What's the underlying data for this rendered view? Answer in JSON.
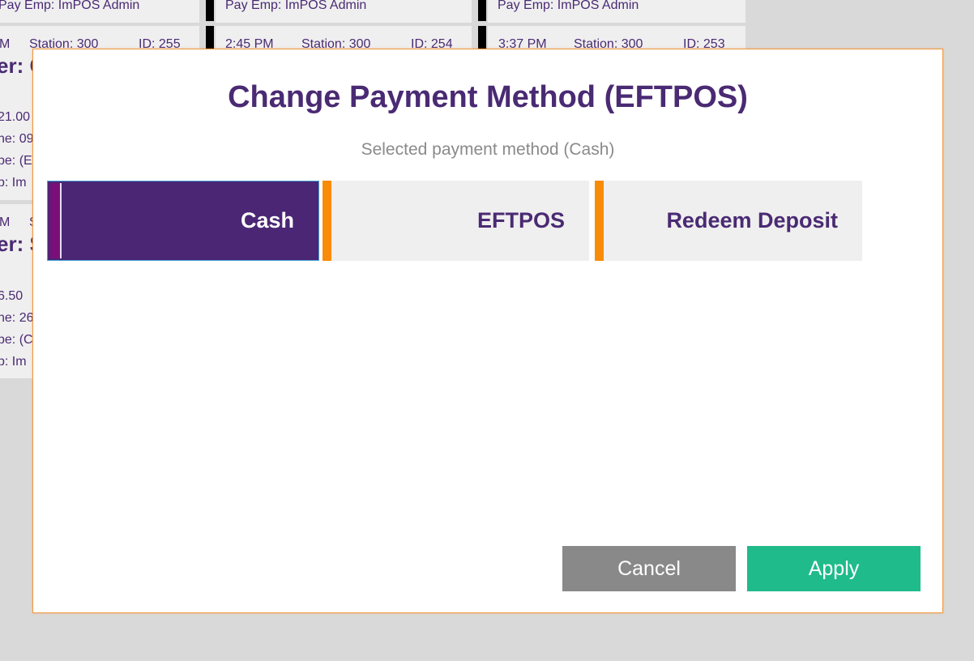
{
  "background": {
    "cards_top": [
      {
        "pay_emp": "Pay Emp: ImPOS Admin"
      },
      {
        "pay_emp": "Pay Emp: ImPOS Admin"
      },
      {
        "pay_emp": "Pay Emp: ImPOS Admin"
      }
    ],
    "cards_header": [
      {
        "time": "M",
        "station": "Station: 300",
        "id": "ID: 255"
      },
      {
        "time": "2:45 PM",
        "station": "Station: 300",
        "id": "ID: 254"
      },
      {
        "time": "3:37 PM",
        "station": "Station: 300",
        "id": "ID: 253"
      }
    ],
    "left_column_partial": {
      "card1_big": "er: C",
      "card1_lines": [
        "21.00",
        "ne: 09",
        "pe: (E",
        "p: Im"
      ],
      "card2_header": [
        "M",
        "S"
      ],
      "card2_big": "er: S",
      "card2_lines": [
        "6.50",
        "ne: 26",
        "pe: (C",
        "p: Im"
      ]
    }
  },
  "modal": {
    "title": "Change Payment Method (EFTPOS)",
    "subtitle": "Selected payment method (Cash)",
    "methods": [
      {
        "label": "Cash",
        "selected": true
      },
      {
        "label": "EFTPOS",
        "selected": false
      },
      {
        "label": "Redeem Deposit",
        "selected": false
      }
    ],
    "cancel_label": "Cancel",
    "apply_label": "Apply"
  },
  "colors": {
    "brand_purple": "#4a2674",
    "accent_orange": "#f88b07",
    "apply_green": "#1fbb8a",
    "cancel_gray": "#898989"
  }
}
